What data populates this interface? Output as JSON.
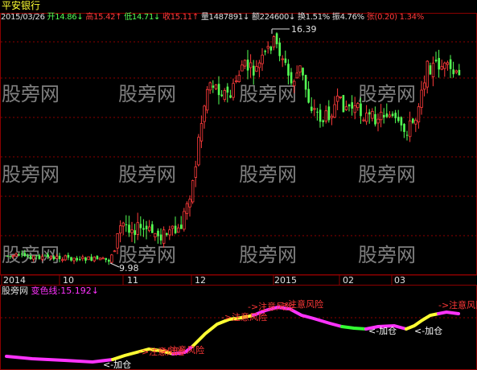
{
  "title": "平安银行",
  "infobar": {
    "date": "2015/03/26",
    "open_label": "开",
    "open": "14.86",
    "open_arrow": "↓",
    "high_label": "高",
    "high": "15.42",
    "high_arrow": "↑",
    "low_label": "低",
    "low": "14.71",
    "low_arrow": "↓",
    "close_label": "收",
    "close": "15.11",
    "close_arrow": "↑",
    "volume_label": "量",
    "volume": "1487891",
    "volume_arrow": "↓",
    "amount_label": "额",
    "amount": "224600",
    "amount_arrow": "↓",
    "turnover_label": "换",
    "turnover": "1.51%",
    "amplitude_label": "振",
    "amplitude": "4.76%",
    "change_label": "张",
    "change": "(0.20)",
    "change_pct": "1.34%"
  },
  "watermark": "股旁网",
  "xaxis": {
    "labels": [
      "2014",
      "10",
      "11",
      "12",
      "2015",
      "02",
      "03"
    ]
  },
  "annotations": {
    "max": "16.39",
    "min": "9.98"
  },
  "indicator": {
    "name": "股旁网",
    "line_label": "变色线:15.192",
    "line_arrow": "↓",
    "risk_label": "->注意风险",
    "add_label": "<-加仓"
  },
  "colors": {
    "up": "#ff3b3b",
    "down": "#54ff54",
    "grid": "#8b0000",
    "text_red": "#ff3b3b",
    "text_green": "#54ff54",
    "text_white": "#e0e0e0",
    "yellow": "#ffff33",
    "magenta": "#ff33ff",
    "green_line": "#33ff33",
    "label_red": "#ff3838",
    "label_white": "#ffffff"
  },
  "chart_data": {
    "type": "candlestick",
    "start_date": "2014-09",
    "end_date": "2015-03-26",
    "price_high": 16.39,
    "price_low": 9.98,
    "last_close": 15.11,
    "indicator_last": 15.192
  }
}
